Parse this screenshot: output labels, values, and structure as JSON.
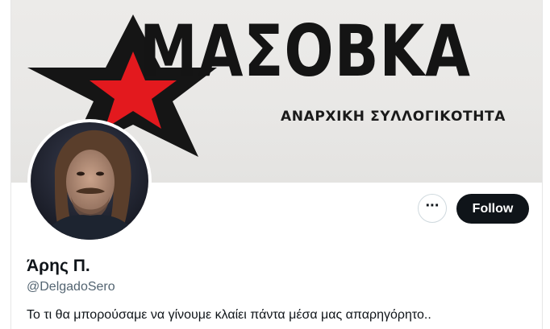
{
  "banner": {
    "title": "ΜΑΣΟΒΚΑ",
    "subtitle": "ΑΝΑΡΧΙΚΗ ΣΥΛΛΟΓΙΚΟΤΗΤΑ",
    "star_color": "#e3191e",
    "outline_color": "#151515"
  },
  "actions": {
    "more_icon": "more-horizontal-icon",
    "more_glyph": "···",
    "follow_label": "Follow",
    "follow_color": "#0f1419"
  },
  "profile": {
    "display_name": "Άρης Π.",
    "handle": "@DelgadoSero",
    "bio": "Το τι θα μπορούσαμε να γίνουμε κλαίει πάντα μέσα μας απαρηγόρητο.."
  }
}
